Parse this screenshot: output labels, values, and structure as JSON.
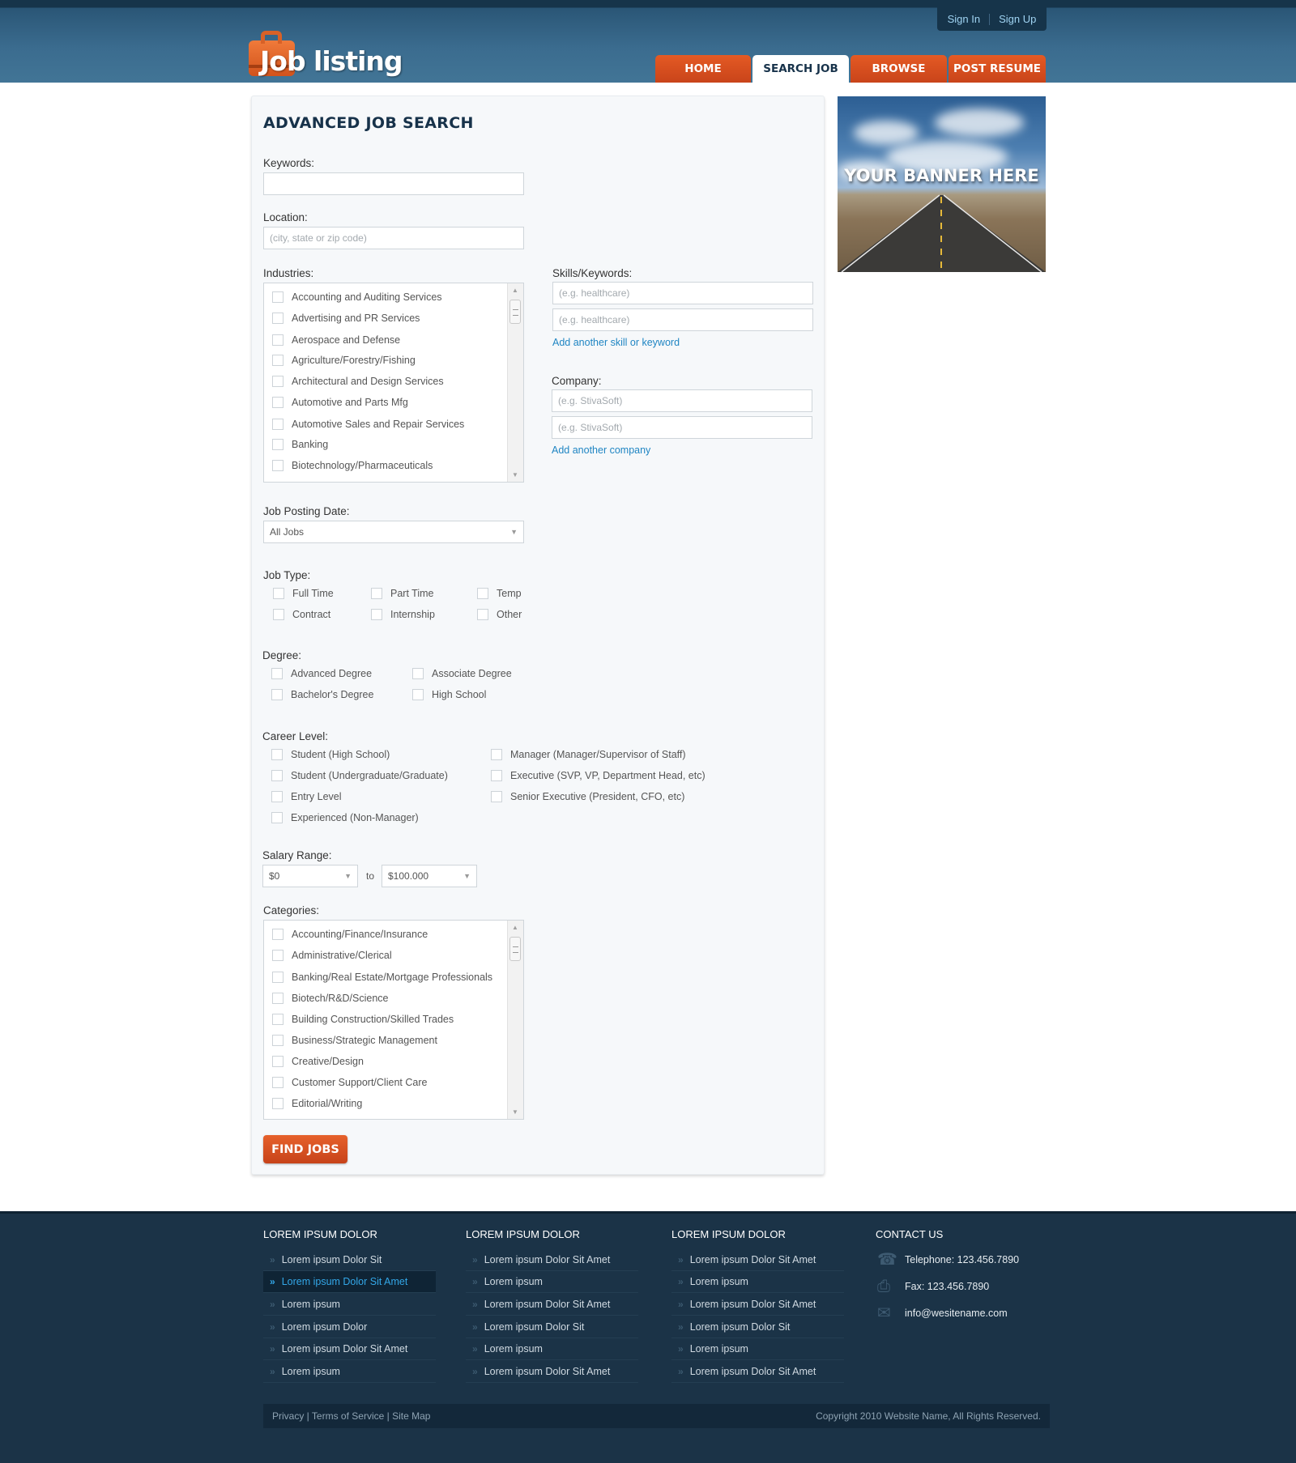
{
  "auth": {
    "sign_in": "Sign In",
    "sign_up": "Sign Up"
  },
  "logo": {
    "text": "Job listing"
  },
  "nav": [
    {
      "label": "HOME",
      "active": false
    },
    {
      "label": "SEARCH JOB",
      "active": true
    },
    {
      "label": "BROWSE",
      "active": false
    },
    {
      "label": "POST RESUME",
      "active": false
    }
  ],
  "search": {
    "title": "ADVANCED JOB SEARCH",
    "keywords_label": "Keywords:",
    "keywords_value": "",
    "location_label": "Location:",
    "location_placeholder": "(city, state or zip code)",
    "industries_label": "Industries:",
    "industries": [
      "Accounting and Auditing Services",
      "Advertising and PR Services",
      "Aerospace and Defense",
      "Agriculture/Forestry/Fishing",
      "Architectural and Design Services",
      "Automotive and Parts Mfg",
      "Automotive Sales and Repair Services",
      "Banking",
      "Biotechnology/Pharmaceuticals"
    ],
    "skills_label": "Skills/Keywords:",
    "skills_placeholder_1": "(e.g. healthcare)",
    "skills_placeholder_2": "(e.g. healthcare)",
    "add_skill": "Add another skill or keyword",
    "company_label": "Company:",
    "company_placeholder_1": "(e.g. StivaSoft)",
    "company_placeholder_2": "(e.g. StivaSoft)",
    "add_company": "Add another company",
    "posting_date_label": "Job Posting Date:",
    "posting_date_value": "All Jobs",
    "job_type_label": "Job Type:",
    "job_types": [
      "Full Time",
      "Part Time",
      "Temp",
      "Contract",
      "Internship",
      "Other"
    ],
    "degree_label": "Degree:",
    "degrees": [
      "Advanced Degree",
      "Associate Degree",
      "Bachelor's Degree",
      "High School"
    ],
    "career_label": "Career Level:",
    "career_left": [
      "Student (High School)",
      "Student (Undergraduate/Graduate)",
      "Entry Level",
      "Experienced (Non-Manager)"
    ],
    "career_right": [
      "Manager (Manager/Supervisor of Staff)",
      "Executive (SVP, VP, Department Head, etc)",
      "Senior Executive (President, CFO, etc)"
    ],
    "salary_label": "Salary Range:",
    "salary_from": "$0",
    "salary_to_word": "to",
    "salary_to": "$100.000",
    "categories_label": "Categories:",
    "categories": [
      "Accounting/Finance/Insurance",
      "Administrative/Clerical",
      "Banking/Real Estate/Mortgage Professionals",
      "Biotech/R&D/Science",
      "Building Construction/Skilled Trades",
      "Business/Strategic Management",
      "Creative/Design",
      "Customer Support/Client Care",
      "Editorial/Writing"
    ],
    "find_button": "FIND JOBS"
  },
  "banner": {
    "text": "YOUR BANNER HERE"
  },
  "footer": {
    "columns": [
      {
        "title": "LOREM IPSUM DOLOR",
        "links": [
          "Lorem ipsum Dolor Sit",
          "Lorem ipsum Dolor Sit Amet",
          "Lorem ipsum",
          "Lorem ipsum Dolor",
          "Lorem ipsum Dolor Sit Amet",
          "Lorem ipsum"
        ]
      },
      {
        "title": "LOREM IPSUM DOLOR",
        "links": [
          "Lorem ipsum Dolor Sit Amet",
          "Lorem ipsum",
          "Lorem ipsum Dolor Sit Amet",
          "Lorem ipsum Dolor Sit",
          "Lorem ipsum",
          "Lorem ipsum Dolor Sit Amet"
        ]
      },
      {
        "title": "LOREM IPSUM DOLOR",
        "links": [
          "Lorem ipsum Dolor Sit Amet",
          "Lorem ipsum",
          "Lorem ipsum Dolor Sit Amet",
          "Lorem ipsum Dolor Sit",
          "Lorem ipsum",
          "Lorem ipsum Dolor Sit Amet"
        ]
      }
    ],
    "contact_title": "CONTACT US",
    "telephone": "Telephone: 123.456.7890",
    "fax": "Fax: 123.456.7890",
    "email": "info@wesitename.com",
    "privacy": "Privacy",
    "terms": "Terms of Service",
    "sitemap": "Site Map",
    "copyright": "Copyright 2010 Website Name, All Rights Reserved."
  },
  "colors": {
    "accent": "#d9501f",
    "header": "#3b6c8f",
    "footer": "#1b3347",
    "link": "#1f85c3"
  }
}
